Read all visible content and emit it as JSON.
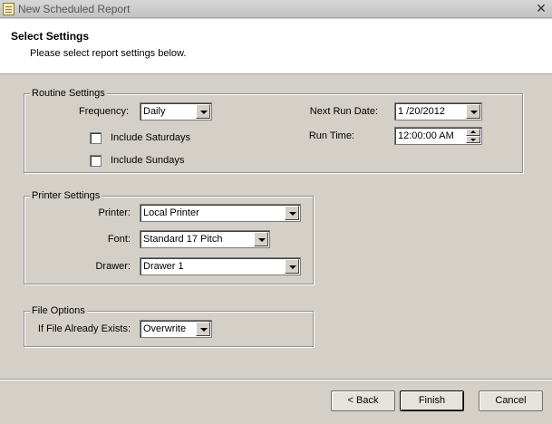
{
  "window": {
    "title": "New Scheduled Report",
    "close_glyph": "✕"
  },
  "header": {
    "title": "Select Settings",
    "subtitle": "Please select report settings below."
  },
  "routine": {
    "group_label": "Routine Settings",
    "frequency_label": "Frequency:",
    "frequency_value": "Daily",
    "include_saturdays_label": "Include Saturdays",
    "include_saturdays_checked": false,
    "include_sundays_label": "Include Sundays",
    "include_sundays_checked": false,
    "next_run_date_label": "Next Run Date:",
    "next_run_date_value": "1 /20/2012",
    "run_time_label": "Run Time:",
    "run_time_value": "12:00:00 AM"
  },
  "printer": {
    "group_label": "Printer Settings",
    "printer_label": "Printer:",
    "printer_value": "Local Printer",
    "font_label": "Font:",
    "font_value": "Standard 17 Pitch",
    "drawer_label": "Drawer:",
    "drawer_value": "Drawer 1"
  },
  "file_options": {
    "group_label": "File Options",
    "exists_label": "If File Already Exists:",
    "exists_value": "Overwrite"
  },
  "footer": {
    "back_label": "< Back",
    "finish_label": "Finish",
    "cancel_label": "Cancel"
  },
  "icons": [
    "report-window-icon",
    "close-icon",
    "dropdown-arrow-icon",
    "spin-up-icon",
    "spin-down-icon"
  ]
}
